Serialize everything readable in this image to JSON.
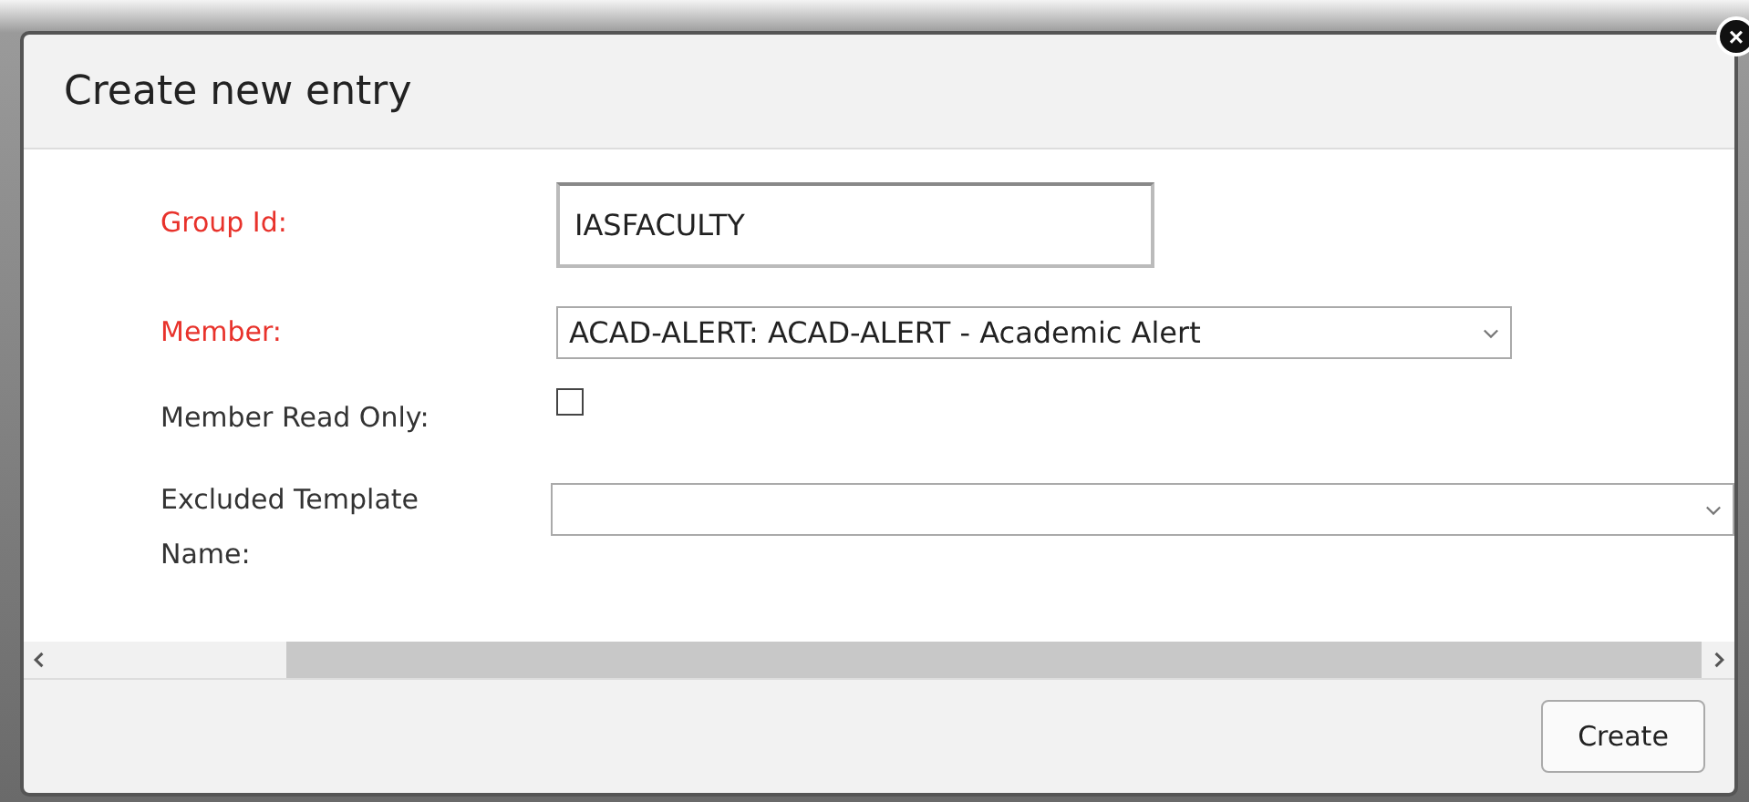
{
  "dialog": {
    "title": "Create new entry",
    "close_label": "×"
  },
  "fields": [
    {
      "kind": "text",
      "label": "Group Id:",
      "required": true,
      "value": "IASFACULTY"
    },
    {
      "kind": "select",
      "label": "Member:",
      "required": true,
      "value": "ACAD-ALERT: ACAD-ALERT - Academic Alert",
      "wide": false
    },
    {
      "kind": "checkbox",
      "label": "Member Read Only:",
      "required": false,
      "checked": false
    },
    {
      "kind": "select",
      "label": "Excluded Template Name:",
      "required": false,
      "wide": true
    }
  ],
  "buttons": [
    {
      "label": "Create"
    }
  ]
}
